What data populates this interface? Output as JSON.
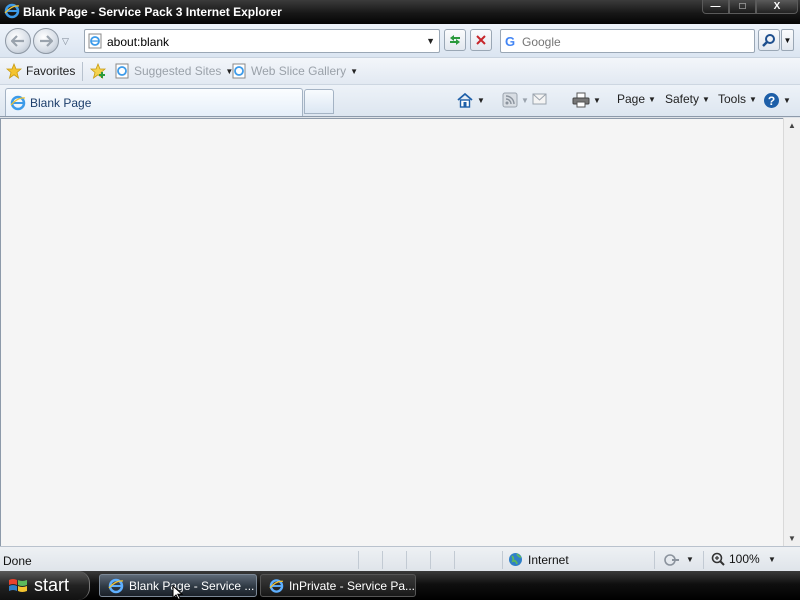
{
  "window": {
    "title": "Blank Page - Service Pack 3 Internet Explorer",
    "minimize_label": "—",
    "maximize_label": "□",
    "close_label": "X"
  },
  "navbar": {
    "address": "about:blank",
    "search_placeholder": "Google",
    "search_engine_glyph": "G"
  },
  "favorites_bar": {
    "favorites_label": "Favorites",
    "suggested_sites_label": "Suggested Sites",
    "web_slice_label": "Web Slice Gallery"
  },
  "tabs": [
    {
      "label": "Blank Page",
      "active": true
    }
  ],
  "command_bar": {
    "page_label": "Page",
    "safety_label": "Safety",
    "tools_label": "Tools"
  },
  "status_bar": {
    "status_text": "Done",
    "zone_label": "Internet",
    "zoom_level": "100%"
  },
  "taskbar": {
    "start_label": "start",
    "tasks": [
      {
        "label": "Blank Page - Service ...",
        "active": true
      },
      {
        "label": "InPrivate - Service Pa...",
        "active": false
      }
    ]
  },
  "colors": {
    "title_bar": "#171717",
    "address_text": "#000000",
    "disabled_link": "#9aa1a9",
    "content_background": "#f5f5f5"
  },
  "icons": [
    "ie-logo-icon",
    "back-arrow-icon",
    "forward-arrow-icon",
    "refresh-icon",
    "stop-icon",
    "search-icon",
    "star-icon",
    "add-favorite-icon",
    "home-icon",
    "feeds-icon",
    "mail-icon",
    "print-icon",
    "help-icon",
    "globe-icon",
    "protected-mode-icon",
    "zoom-icon",
    "windows-logo-icon",
    "mouse-cursor-icon"
  ]
}
